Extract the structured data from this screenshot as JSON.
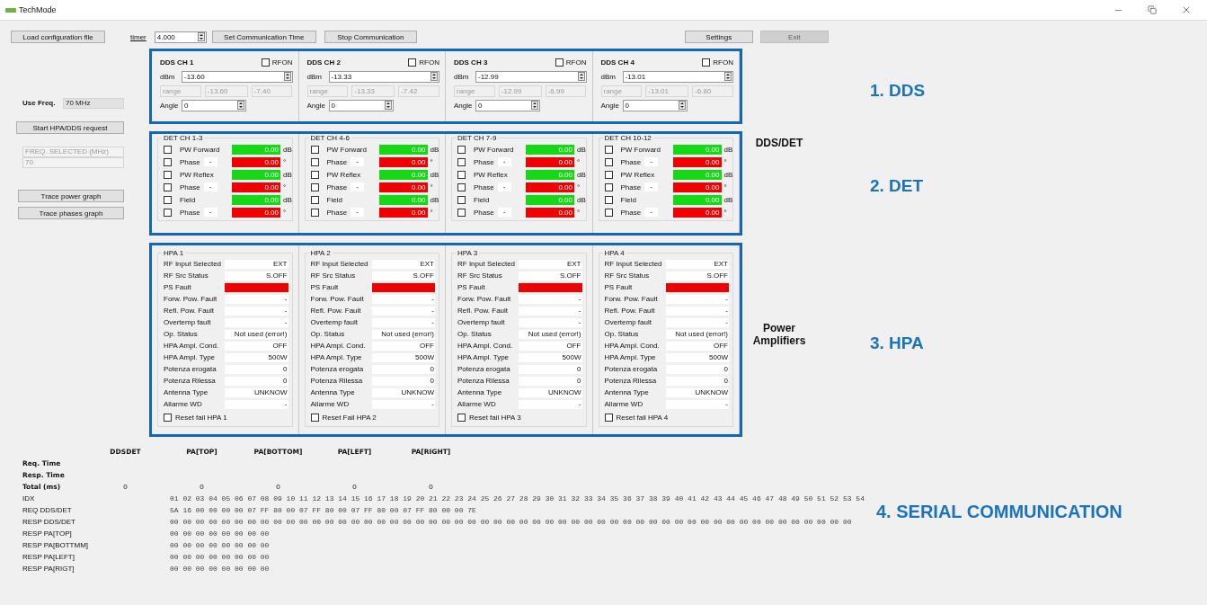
{
  "window": {
    "title": "TechMode"
  },
  "toolbar": {
    "load_button": "Load configuration file",
    "timer_label": "timer",
    "timer_value": "4.000",
    "set_time_button": "Set Communication Time",
    "stop_button": "Stop Communication",
    "settings_button": "Settings",
    "exit_button": {
      "label": "Exit",
      "disabled": true
    }
  },
  "left_panel": {
    "use_freq_label": "Use Freq.",
    "use_freq_value": "70 MHz",
    "start_button": "Start HPA/DDS request",
    "freq_selected": "FREQ. SELECTED (MHz)",
    "freq_value": "70",
    "trace_buttons": [
      "Trace power graph",
      "Trace phases graph"
    ]
  },
  "dds": [
    {
      "title": "DDS CH 1",
      "rfon": {
        "label": "RFON",
        "checked": false
      },
      "dbm_label": "dBm",
      "dbm": "-13.60",
      "range_label": "range",
      "range_min": "-13.60",
      "range_max": "-7.40",
      "angle_label": "Angle",
      "angle": "0"
    },
    {
      "title": "DDS CH 2",
      "rfon": {
        "label": "RFON",
        "checked": false
      },
      "dbm_label": "dBm",
      "dbm": "-13.33",
      "range_label": "range",
      "range_min": "-13.33",
      "range_max": "-7.42",
      "angle_label": "Angle",
      "angle": "0"
    },
    {
      "title": "DDS CH 3",
      "rfon": {
        "label": "RFON",
        "checked": false
      },
      "dbm_label": "dBm",
      "dbm": "-12.99",
      "range_label": "range",
      "range_min": "-12.99",
      "range_max": "-6.99",
      "angle_label": "Angle",
      "angle": "0"
    },
    {
      "title": "DDS CH 4",
      "rfon": {
        "label": "RFON",
        "checked": false
      },
      "dbm_label": "dBm",
      "dbm": "-13.01",
      "range_label": "range",
      "range_min": "-13.01",
      "range_max": "-6.80",
      "angle_label": "Angle",
      "angle": "0"
    }
  ],
  "det": [
    {
      "title": "DET CH 1-3",
      "rows": [
        {
          "kind": "power",
          "label": "PW Forward",
          "value": "0.00",
          "unit": "dB",
          "checked": false
        },
        {
          "kind": "phase",
          "label": "Phase",
          "sign": "-",
          "value": "0.00",
          "unit": "°",
          "checked": false
        },
        {
          "kind": "power",
          "label": "PW Reflex",
          "value": "0.00",
          "unit": "dB",
          "checked": false
        },
        {
          "kind": "phase",
          "label": "Phase",
          "sign": "-",
          "value": "0.00",
          "unit": "°",
          "checked": false
        },
        {
          "kind": "power",
          "label": "Field",
          "value": "0.00",
          "unit": "dB",
          "checked": false
        },
        {
          "kind": "phase",
          "label": "Phase",
          "sign": "-",
          "value": "0.00",
          "unit": "°",
          "checked": false
        }
      ]
    },
    {
      "title": "DET CH 4-6",
      "rows": [
        {
          "kind": "power",
          "label": "PW Forward",
          "value": "0.00",
          "unit": "dB",
          "checked": false
        },
        {
          "kind": "phase",
          "label": "Phase",
          "sign": "-",
          "value": "0.00",
          "unit": "°",
          "checked": false
        },
        {
          "kind": "power",
          "label": "PW Reflex",
          "value": "0.00",
          "unit": "dB",
          "checked": false
        },
        {
          "kind": "phase",
          "label": "Phase",
          "sign": "-",
          "value": "0.00",
          "unit": "°",
          "checked": false
        },
        {
          "kind": "power",
          "label": "Field",
          "value": "0.00",
          "unit": "dB",
          "checked": false
        },
        {
          "kind": "phase",
          "label": "Phase",
          "sign": "-",
          "value": "0.00",
          "unit": "°",
          "checked": false
        }
      ]
    },
    {
      "title": "DET CH 7-9",
      "rows": [
        {
          "kind": "power",
          "label": "PW Forward",
          "value": "0.00",
          "unit": "dB",
          "checked": false
        },
        {
          "kind": "phase",
          "label": "Phase",
          "sign": "-",
          "value": "0.00",
          "unit": "°",
          "checked": false
        },
        {
          "kind": "power",
          "label": "PW Reflex",
          "value": "0.00",
          "unit": "dB",
          "checked": false
        },
        {
          "kind": "phase",
          "label": "Phase",
          "sign": "-",
          "value": "0.00",
          "unit": "°",
          "checked": false
        },
        {
          "kind": "power",
          "label": "Field",
          "value": "0.00",
          "unit": "dB",
          "checked": false
        },
        {
          "kind": "phase",
          "label": "Phase",
          "sign": "-",
          "value": "0.00",
          "unit": "°",
          "checked": false
        }
      ]
    },
    {
      "title": "DET CH 10-12",
      "rows": [
        {
          "kind": "power",
          "label": "PW Forward",
          "value": "0.00",
          "unit": "dB",
          "checked": false
        },
        {
          "kind": "phase",
          "label": "Phase",
          "sign": "-",
          "value": "0.00",
          "unit": "°",
          "checked": false
        },
        {
          "kind": "power",
          "label": "PW Reflex",
          "value": "0.00",
          "unit": "dB",
          "checked": false
        },
        {
          "kind": "phase",
          "label": "Phase",
          "sign": "-",
          "value": "0.00",
          "unit": "°",
          "checked": false
        },
        {
          "kind": "power",
          "label": "Field",
          "value": "0.00",
          "unit": "dB",
          "checked": false
        },
        {
          "kind": "phase",
          "label": "Phase",
          "sign": "-",
          "value": "0.00",
          "unit": "°",
          "checked": false
        }
      ]
    }
  ],
  "hpa": [
    {
      "title": "HPA 1",
      "fields": [
        {
          "label": "RF Input Selected",
          "value": "EXT",
          "fault": false
        },
        {
          "label": "RF Src Status",
          "value": "S.OFF",
          "fault": false
        },
        {
          "label": "PS Fault",
          "value": "-",
          "fault": true
        },
        {
          "label": "Forw. Pow. Fault",
          "value": "-",
          "fault": false
        },
        {
          "label": "Refl. Pow. Fault",
          "value": "-",
          "fault": false
        },
        {
          "label": "Overtemp fault",
          "value": "-",
          "fault": false
        },
        {
          "label": "Op. Status",
          "value": "Not used (error!)",
          "fault": false
        },
        {
          "label": "HPA Ampl. Cond.",
          "value": "OFF",
          "fault": false
        },
        {
          "label": "HPA Ampl. Type",
          "value": "500W",
          "fault": false
        },
        {
          "label": "Potenza erogata",
          "value": "0",
          "fault": false
        },
        {
          "label": "Potenza Rilessa",
          "value": "0",
          "fault": false
        },
        {
          "label": "Antenna Type",
          "value": "UNKNOW",
          "fault": false
        },
        {
          "label": "Allarme WD",
          "value": "-",
          "fault": false
        }
      ],
      "reset": {
        "label": "Reset fail HPA 1",
        "checked": false
      }
    },
    {
      "title": "HPA 2",
      "fields": [
        {
          "label": "RF Input Selected",
          "value": "EXT",
          "fault": false
        },
        {
          "label": "RF Src Status",
          "value": "S.OFF",
          "fault": false
        },
        {
          "label": "PS Fault",
          "value": "-",
          "fault": true
        },
        {
          "label": "Forw. Pow. Fault",
          "value": "-",
          "fault": false
        },
        {
          "label": "Refl. Pow. Fault",
          "value": "-",
          "fault": false
        },
        {
          "label": "Overtemp fault",
          "value": "-",
          "fault": false
        },
        {
          "label": "Op. Status",
          "value": "Not used (error!)",
          "fault": false
        },
        {
          "label": "HPA Ampl. Cond.",
          "value": "OFF",
          "fault": false
        },
        {
          "label": "HPA Ampl. Type",
          "value": "500W",
          "fault": false
        },
        {
          "label": "Potenza erogata",
          "value": "0",
          "fault": false
        },
        {
          "label": "Potenza Rilessa",
          "value": "0",
          "fault": false
        },
        {
          "label": "Antenna Type",
          "value": "UNKNOW",
          "fault": false
        },
        {
          "label": "Allarme WD",
          "value": "-",
          "fault": false
        }
      ],
      "reset": {
        "label": "Reset Fail HPA 2",
        "checked": false
      }
    },
    {
      "title": "HPA 3",
      "fields": [
        {
          "label": "RF Input Selected",
          "value": "EXT",
          "fault": false
        },
        {
          "label": "RF Src Status",
          "value": "S.OFF",
          "fault": false
        },
        {
          "label": "PS Fault",
          "value": "-",
          "fault": true
        },
        {
          "label": "Forw. Pow. Fault",
          "value": "-",
          "fault": false
        },
        {
          "label": "Refl. Pow. Fault",
          "value": "-",
          "fault": false
        },
        {
          "label": "Overtemp fault",
          "value": "-",
          "fault": false
        },
        {
          "label": "Op. Status",
          "value": "Not used (error!)",
          "fault": false
        },
        {
          "label": "HPA Ampl. Cond.",
          "value": "OFF",
          "fault": false
        },
        {
          "label": "HPA Ampl. Type",
          "value": "500W",
          "fault": false
        },
        {
          "label": "Potenza erogata",
          "value": "0",
          "fault": false
        },
        {
          "label": "Potenza Rilessa",
          "value": "0",
          "fault": false
        },
        {
          "label": "Antenna Type",
          "value": "UNKNOW",
          "fault": false
        },
        {
          "label": "Allarme WD",
          "value": "-",
          "fault": false
        }
      ],
      "reset": {
        "label": "Reset fail HPA 3",
        "checked": false
      }
    },
    {
      "title": "HPA 4",
      "fields": [
        {
          "label": "RF Input Selected",
          "value": "EXT",
          "fault": false
        },
        {
          "label": "RF Src Status",
          "value": "S.OFF",
          "fault": false
        },
        {
          "label": "PS Fault",
          "value": "-",
          "fault": true
        },
        {
          "label": "Forw. Pow. Fault",
          "value": "-",
          "fault": false
        },
        {
          "label": "Refl. Pow. Fault",
          "value": "-",
          "fault": false
        },
        {
          "label": "Overtemp fault",
          "value": "-",
          "fault": false
        },
        {
          "label": "Op. Status",
          "value": "Not used (error!)",
          "fault": false
        },
        {
          "label": "HPA Ampl. Cond.",
          "value": "OFF",
          "fault": false
        },
        {
          "label": "HPA Ampl. Type",
          "value": "500W",
          "fault": false
        },
        {
          "label": "Potenza erogata",
          "value": "0",
          "fault": false
        },
        {
          "label": "Potenza Rilessa",
          "value": "0",
          "fault": false
        },
        {
          "label": "Antenna Type",
          "value": "UNKNOW",
          "fault": false
        },
        {
          "label": "Allarme WD",
          "value": "-",
          "fault": false
        }
      ],
      "reset": {
        "label": "Reset fail HPA 4",
        "checked": false
      }
    }
  ],
  "side_labels": {
    "det": "DDS/DET",
    "hpa": "Power Amplifiers"
  },
  "section_labels": [
    "1. DDS",
    "2. DET",
    "3. HPA",
    "4. SERIAL COMMUNICATION"
  ],
  "serial": {
    "headers": [
      "DDSDET",
      "PA[TOP]",
      "PA[BOTTOM]",
      "PA[LEFT]",
      "PA[RIGHT]"
    ],
    "time_rows": [
      {
        "label": "Req. Time"
      },
      {
        "label": "Resp. Time"
      },
      {
        "label": "Total (ms)",
        "values": [
          "0",
          "0",
          "0",
          "0",
          "0"
        ]
      }
    ],
    "hex_rows": [
      {
        "label": "IDX",
        "bytes": "01 02 03 04 05 06 07 08 09 10 11 12 13 14 15 16 17 18 19 20 21 22 23 24 25 26 27 28 29 30 31 32 33 34 35 36 37 38 39 40 41 42 43 44 45 46 47 48 49 50 51 52 53 54"
      },
      {
        "label": "REQ DDS/DET",
        "bytes": "5A 16 00 00 00 00 07 FF 80 00 07 FF 80 00 07 FF 80 00 07 FF 80 00 00 7E"
      },
      {
        "label": "RESP DDS/DET",
        "bytes": "00 00 00 00 00 00 00 00 00 00 00 00 00 00 00 00 00 00 00 00 00 00 00 00 00 00 00 00 00 00 00 00 00 00 00 00 00 00 00 00 00 00 00 00 00 00 00 00 00 00 00 00 00"
      },
      {
        "label": "RESP PA[TOP]",
        "bytes": "00 00 00 00 00 00 00 00"
      },
      {
        "label": "RESP PA[BOTTMM]",
        "bytes": "00 00 00 00 00 00 00 00"
      },
      {
        "label": "RESP PA[LEFT]",
        "bytes": "00 00 00 00 00 00 00 00"
      },
      {
        "label": "RESP PA[RIGT]",
        "bytes": "00 00 00 00 00 00 00 00"
      }
    ]
  }
}
